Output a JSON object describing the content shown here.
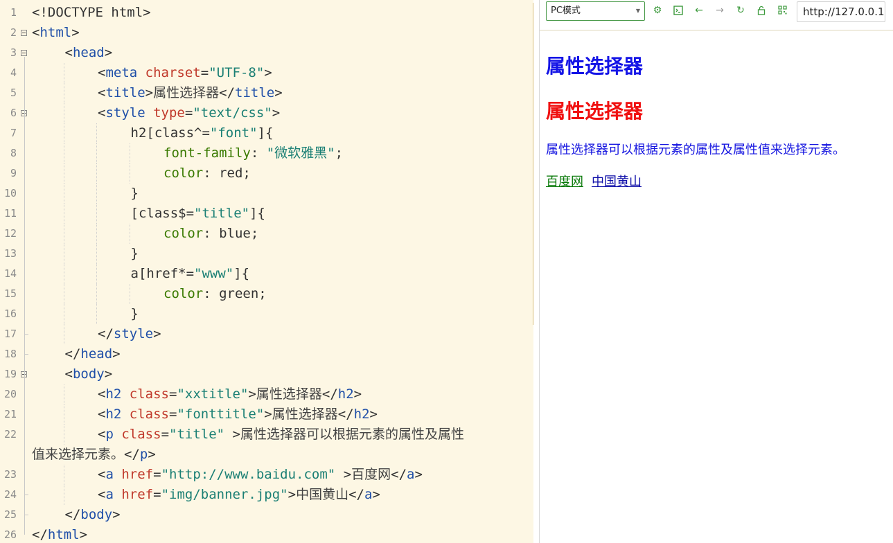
{
  "editor": {
    "lines": [
      {
        "n": "1",
        "indent": 0,
        "tokens": [
          [
            "p",
            "<!DOCTYPE html>"
          ]
        ]
      },
      {
        "n": "2",
        "indent": 0,
        "tokens": [
          [
            "p",
            "<"
          ],
          [
            "t",
            "html"
          ],
          [
            "p",
            ">"
          ]
        ]
      },
      {
        "n": "3",
        "indent": 1,
        "tokens": [
          [
            "p",
            "<"
          ],
          [
            "t",
            "head"
          ],
          [
            "p",
            ">"
          ]
        ]
      },
      {
        "n": "4",
        "indent": 2,
        "tokens": [
          [
            "p",
            "<"
          ],
          [
            "t",
            "meta"
          ],
          [
            "p",
            " "
          ],
          [
            "a",
            "charset"
          ],
          [
            "p",
            "="
          ],
          [
            "s",
            "\"UTF-8\""
          ],
          [
            "p",
            ">"
          ]
        ]
      },
      {
        "n": "5",
        "indent": 2,
        "tokens": [
          [
            "p",
            "<"
          ],
          [
            "t",
            "title"
          ],
          [
            "p",
            ">"
          ],
          [
            "x",
            "属性选择器"
          ],
          [
            "p",
            "</"
          ],
          [
            "t",
            "title"
          ],
          [
            "p",
            ">"
          ]
        ]
      },
      {
        "n": "6",
        "indent": 2,
        "tokens": [
          [
            "p",
            "<"
          ],
          [
            "t",
            "style"
          ],
          [
            "p",
            " "
          ],
          [
            "a",
            "type"
          ],
          [
            "p",
            "="
          ],
          [
            "s",
            "\"text/css\""
          ],
          [
            "p",
            ">"
          ]
        ]
      },
      {
        "n": "7",
        "indent": 3,
        "tokens": [
          [
            "v",
            "h2[class^="
          ],
          [
            "s",
            "\"font\""
          ],
          [
            "v",
            "]{"
          ]
        ]
      },
      {
        "n": "8",
        "indent": 4,
        "tokens": [
          [
            "c",
            "font-family"
          ],
          [
            "v",
            ": "
          ],
          [
            "s",
            "\"微软雅黑\""
          ],
          [
            "v",
            ";"
          ]
        ]
      },
      {
        "n": "9",
        "indent": 4,
        "tokens": [
          [
            "c",
            "color"
          ],
          [
            "v",
            ": red;"
          ]
        ]
      },
      {
        "n": "10",
        "indent": 3,
        "tokens": [
          [
            "v",
            "}"
          ]
        ]
      },
      {
        "n": "11",
        "indent": 3,
        "tokens": [
          [
            "v",
            "[class$="
          ],
          [
            "s",
            "\"title\""
          ],
          [
            "v",
            "]{"
          ]
        ]
      },
      {
        "n": "12",
        "indent": 4,
        "tokens": [
          [
            "c",
            "color"
          ],
          [
            "v",
            ": blue;"
          ]
        ]
      },
      {
        "n": "13",
        "indent": 3,
        "tokens": [
          [
            "v",
            "}"
          ]
        ]
      },
      {
        "n": "14",
        "indent": 3,
        "tokens": [
          [
            "v",
            "a[href*="
          ],
          [
            "s",
            "\"www\""
          ],
          [
            "v",
            "]{"
          ]
        ]
      },
      {
        "n": "15",
        "indent": 4,
        "tokens": [
          [
            "c",
            "color"
          ],
          [
            "v",
            ": green;"
          ]
        ]
      },
      {
        "n": "16",
        "indent": 3,
        "tokens": [
          [
            "v",
            "}"
          ]
        ]
      },
      {
        "n": "17",
        "indent": 2,
        "tokens": [
          [
            "p",
            "</"
          ],
          [
            "t",
            "style"
          ],
          [
            "p",
            ">"
          ]
        ]
      },
      {
        "n": "18",
        "indent": 1,
        "tokens": [
          [
            "p",
            "</"
          ],
          [
            "t",
            "head"
          ],
          [
            "p",
            ">"
          ]
        ]
      },
      {
        "n": "19",
        "indent": 1,
        "tokens": [
          [
            "p",
            "<"
          ],
          [
            "t",
            "body"
          ],
          [
            "p",
            ">"
          ]
        ]
      },
      {
        "n": "20",
        "indent": 2,
        "tokens": [
          [
            "p",
            "<"
          ],
          [
            "t",
            "h2"
          ],
          [
            "p",
            " "
          ],
          [
            "a",
            "class"
          ],
          [
            "p",
            "="
          ],
          [
            "s",
            "\"xxtitle\""
          ],
          [
            "p",
            ">"
          ],
          [
            "x",
            "属性选择器"
          ],
          [
            "p",
            "</"
          ],
          [
            "t",
            "h2"
          ],
          [
            "p",
            ">"
          ]
        ]
      },
      {
        "n": "21",
        "indent": 2,
        "tokens": [
          [
            "p",
            "<"
          ],
          [
            "t",
            "h2"
          ],
          [
            "p",
            " "
          ],
          [
            "a",
            "class"
          ],
          [
            "p",
            "="
          ],
          [
            "s",
            "\"fonttitle\""
          ],
          [
            "p",
            ">"
          ],
          [
            "x",
            "属性选择器"
          ],
          [
            "p",
            "</"
          ],
          [
            "t",
            "h2"
          ],
          [
            "p",
            ">"
          ]
        ]
      },
      {
        "n": "22",
        "indent": 2,
        "tokens": [
          [
            "p",
            "<"
          ],
          [
            "t",
            "p"
          ],
          [
            "p",
            " "
          ],
          [
            "a",
            "class"
          ],
          [
            "p",
            "="
          ],
          [
            "s",
            "\"title\""
          ],
          [
            "p",
            " >"
          ],
          [
            "x",
            "属性选择器可以根据元素的属性及属性"
          ]
        ]
      },
      {
        "n": "",
        "indent": 0,
        "tokens": [
          [
            "x",
            "值来选择元素。"
          ],
          [
            "p",
            "</"
          ],
          [
            "t",
            "p"
          ],
          [
            "p",
            ">"
          ]
        ]
      },
      {
        "n": "23",
        "indent": 2,
        "tokens": [
          [
            "p",
            "<"
          ],
          [
            "t",
            "a"
          ],
          [
            "p",
            " "
          ],
          [
            "a",
            "href"
          ],
          [
            "p",
            "="
          ],
          [
            "s",
            "\"http://www.baidu.com\""
          ],
          [
            "p",
            " >"
          ],
          [
            "x",
            "百度网"
          ],
          [
            "p",
            "</"
          ],
          [
            "t",
            "a"
          ],
          [
            "p",
            ">"
          ]
        ]
      },
      {
        "n": "24",
        "indent": 2,
        "tokens": [
          [
            "p",
            "<"
          ],
          [
            "t",
            "a"
          ],
          [
            "p",
            " "
          ],
          [
            "a",
            "href"
          ],
          [
            "p",
            "="
          ],
          [
            "s",
            "\"img/banner.jpg\""
          ],
          [
            "p",
            ">"
          ],
          [
            "x",
            "中国黄山"
          ],
          [
            "p",
            "</"
          ],
          [
            "t",
            "a"
          ],
          [
            "p",
            ">"
          ]
        ]
      },
      {
        "n": "25",
        "indent": 1,
        "tokens": [
          [
            "p",
            "</"
          ],
          [
            "t",
            "body"
          ],
          [
            "p",
            ">"
          ]
        ]
      },
      {
        "n": "26",
        "indent": 0,
        "tokens": [
          [
            "p",
            "</"
          ],
          [
            "t",
            "html"
          ],
          [
            "p",
            ">"
          ]
        ]
      }
    ]
  },
  "preview": {
    "mode_label": "PC模式",
    "url": "http://127.0.0.1",
    "heading_blue": "属性选择器",
    "heading_red": "属性选择器",
    "paragraph": "属性选择器可以根据元素的属性及属性值来选择元素。",
    "link_baidu": "百度网",
    "link_huangshan": "中国黄山",
    "colors": {
      "heading_blue": "#1414e6",
      "heading_red": "#f01010",
      "link_green": "#0a7a0a",
      "link_default": "#0f0fa8",
      "accent_green": "#3c9a3c"
    },
    "toolbar_icons": [
      "settings-icon",
      "console-icon",
      "back-arrow-icon",
      "forward-arrow-icon",
      "refresh-icon",
      "lock-icon",
      "qr-code-icon"
    ]
  }
}
